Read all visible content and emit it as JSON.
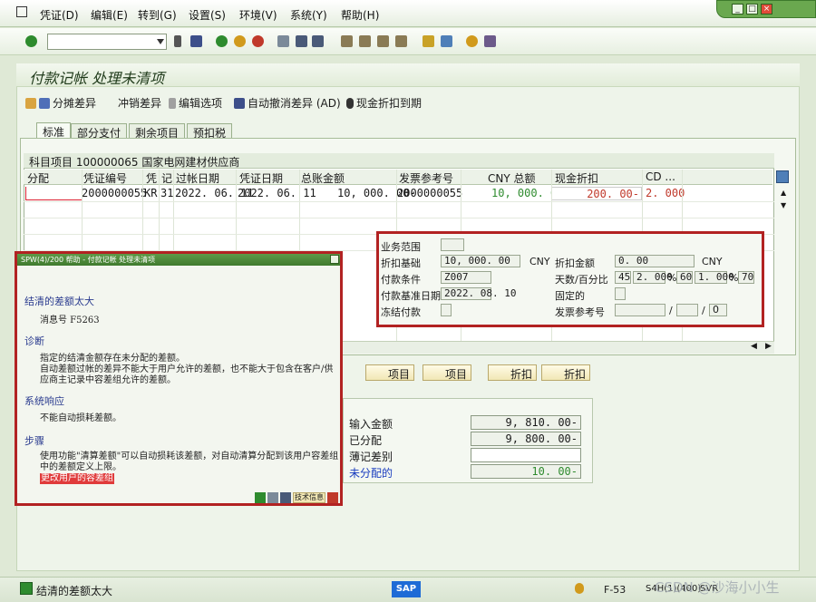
{
  "menu": {
    "items": [
      "凭证(D)",
      "编辑(E)",
      "转到(G)",
      "设置(S)",
      "环境(V)",
      "系统(Y)",
      "帮助(H)"
    ]
  },
  "window_controls": {
    "minimize": "_",
    "restore": "□",
    "close": "×"
  },
  "toolbar": {
    "command_value": ""
  },
  "screen": {
    "title": "付款记帐 处理未清项"
  },
  "app_toolbar": {
    "items": [
      "分摊差异",
      "冲销差异",
      "编辑选项",
      "自动撤消差异 (AD)",
      "现金折扣到期"
    ]
  },
  "tabs": [
    "标准",
    "部分支付",
    "剩余项目",
    "预扣税"
  ],
  "grid": {
    "title": "科目项目 100000065 国家电网建材供应商",
    "columns": [
      "分配",
      "凭证编号",
      "凭",
      "记",
      "过帐日期",
      "凭证日期",
      "总账金额",
      "发票参考号",
      "CNY 总额",
      "现金折扣",
      "CD ..."
    ],
    "row": {
      "assignment": "",
      "doc_no": "2000000055",
      "doc_type": "KR",
      "pk": "31",
      "posting_date": "2022. 06. 11",
      "doc_date": "2022. 06. 11",
      "amount": "10, 000. 00-",
      "invoice_ref": "2000000055",
      "gross": "10, 000. 00-",
      "cash_disc": "200. 00-",
      "cd_pct": "2. 000"
    }
  },
  "detail": {
    "business_area_label": "业务范围",
    "business_area": "",
    "disc_base_label": "折扣基础",
    "disc_base": "10, 000. 00",
    "currency1": "CNY",
    "disc_amount_label": "折扣金额",
    "disc_amount": "0. 00",
    "currency2": "CNY",
    "payment_terms_label": "付款条件",
    "payment_terms": "Z007",
    "days_pct_label": "天数/百分比",
    "days1": "45",
    "pct1": "2. 000",
    "days2": "60",
    "pct2": "1. 000",
    "days3": "70",
    "baseline_label": "付款基准日期",
    "baseline": "2022. 08. 10",
    "fixed_label": "固定的",
    "freeze_label": "冻结付款",
    "invoice_ref_label": "发票参考号",
    "inv1": "",
    "inv2": "",
    "inv3": "0"
  },
  "action_buttons": [
    "项目",
    "项目",
    "折扣",
    "折扣"
  ],
  "summary": {
    "entered_label": "输入金额",
    "entered": "9, 810. 00-",
    "assigned_label": "已分配",
    "assigned": "9, 800. 00-",
    "diff_label": "薄记差别",
    "diff": "",
    "unassigned_label": "未分配的",
    "unassigned": "10. 00-"
  },
  "help": {
    "header": "SPW(4)/200 帮助 - 付款记帐 处理未清项",
    "heading1": "结清的差额太大",
    "msg_no": "消息号 F5263",
    "heading2": "诊断",
    "diag": "指定的结清金额存在未分配的差额。\n自动差额过帐的差异不能大于用户允许的差额，也不能大于包含在客户/供应商主记录中容差组允许的差额。",
    "heading3": "系统响应",
    "response": "不能自动损耗差额。",
    "heading4": "步骤",
    "procedure": "使用功能\"清算差额\"可以自动损耗该差额，对自动清算分配到该用户容差组中的差额定义上限。",
    "link": "更改用户的容差组",
    "tech_btn": "技术信息"
  },
  "status": {
    "message": "结清的差额太大",
    "transaction": "F-53",
    "system": "S4H(1)(400)",
    "host": "SVR"
  },
  "watermark": "CSDN @沙海小小生",
  "colors": {
    "accent_red": "#b22222",
    "green_text": "#2e8b2e",
    "link_blue": "#1a3dbf",
    "sap_blue": "#1e6bd6"
  }
}
